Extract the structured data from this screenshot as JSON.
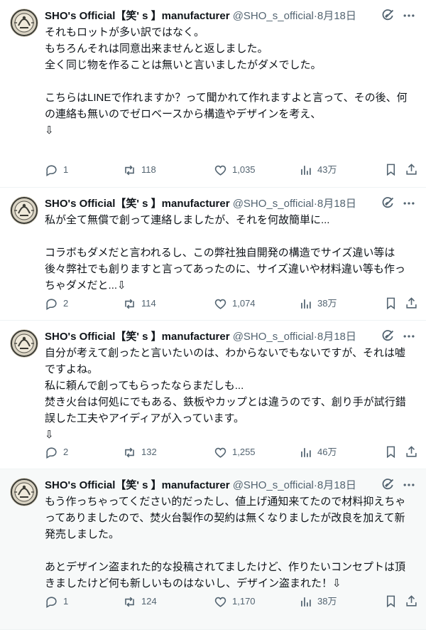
{
  "tweets": [
    {
      "name": "SHO's Official【笑' s 】manufacturer",
      "handle": "@SHO_s_official",
      "sep": "·",
      "date": "8月18日",
      "lines": [
        "それもロットが多い訳ではなく。",
        "もちろんそれは同意出来ませんと返しました。",
        "全く同じ物を作ることは無いと言いましたがダメでした。",
        "",
        "こちらはLINEで作れますか？って聞かれて作れますよと言って、その後、何",
        "の連絡も無いのでゼロベースから構造やデザインを考え、",
        "⇩"
      ],
      "replies": "1",
      "reposts": "118",
      "likes": "1,035",
      "views": "43万",
      "highlighted": false
    },
    {
      "name": "SHO's Official【笑' s 】manufacturer",
      "handle": "@SHO_s_official",
      "sep": "·",
      "date": "8月18日",
      "lines": [
        "私が全て無償で創って連絡しましたが、それを何故簡単に...",
        "",
        "コラボもダメだと言われるし、この弊社独自開発の構造でサイズ違い等は",
        "後々弊社でも創りますと言ってあったのに、サイズ違いや材料違い等も作っ",
        "ちゃダメだと...⇩"
      ],
      "replies": "2",
      "reposts": "114",
      "likes": "1,074",
      "views": "38万",
      "highlighted": false
    },
    {
      "name": "SHO's Official【笑' s 】manufacturer",
      "handle": "@SHO_s_official",
      "sep": "·",
      "date": "8月18日",
      "lines": [
        "自分が考えて創ったと言いたいのは、わからないでもないですが、それは嘘",
        "ですよね。",
        "私に頼んで創ってもらったならまだしも...",
        "焚き火台は何処にでもある、鉄板やカップとは違うのです、創り手が試行錯",
        "誤した工夫やアイディアが入っています。",
        "⇩"
      ],
      "replies": "2",
      "reposts": "132",
      "likes": "1,255",
      "views": "46万",
      "highlighted": false
    },
    {
      "name": "SHO's Official【笑' s 】manufacturer",
      "handle": "@SHO_s_official",
      "sep": "·",
      "date": "8月18日",
      "lines": [
        "もう作っちゃってください的だったし、値上げ通知来てたので材料抑えちゃ",
        "ってありましたので、焚火台製作の契約は無くなりましたが改良を加えて新",
        "発売しました。",
        "",
        "あとデザイン盗まれた的な投稿されてましたけど、作りたいコンセプトは頂",
        "きましたけど何も新しいものはないし、デザイン盗まれた！⇩"
      ],
      "replies": "1",
      "reposts": "124",
      "likes": "1,170",
      "views": "38万",
      "highlighted": true
    }
  ],
  "icons": {
    "avatar": "avatar-icon",
    "grok": "grok-icon",
    "more": "more-icon",
    "reply": "reply-icon",
    "repost": "repost-icon",
    "like": "like-icon",
    "views": "views-icon",
    "bookmark": "bookmark-icon",
    "share": "share-icon"
  },
  "colors": {
    "text": "#0f1419",
    "secondary": "#536471",
    "highlight_bg": "#f7f9f9",
    "divider": "#eff3f4"
  }
}
